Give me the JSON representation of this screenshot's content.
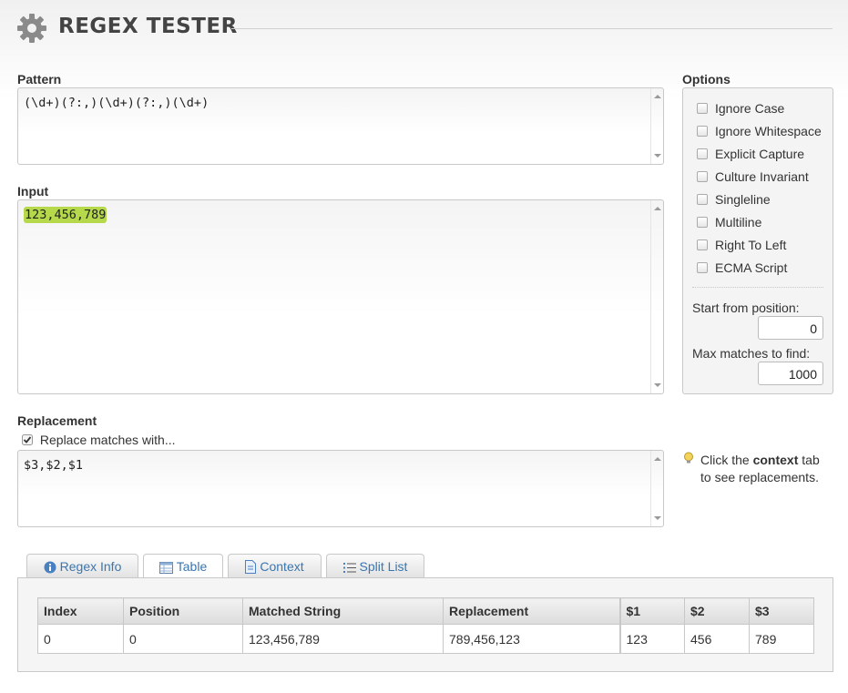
{
  "header": {
    "title": "REGEX TESTER",
    "logo_icon": "gear-icon"
  },
  "pattern": {
    "label": "Pattern",
    "value": "(\\d+)(?:,)(\\d+)(?:,)(\\d+)"
  },
  "input": {
    "label": "Input",
    "value": "123,456,789",
    "match_highlight_color": "#b5d94b"
  },
  "replacement": {
    "label": "Replacement",
    "checkbox_label": "Replace matches with...",
    "checkbox_checked": true,
    "value": "$3,$2,$1",
    "hint_prefix": "Click the ",
    "hint_bold": "context",
    "hint_suffix": " tab",
    "hint_line2": "to see replacements.",
    "hint_icon": "lightbulb-icon"
  },
  "options": {
    "label": "Options",
    "items": [
      {
        "label": "Ignore Case",
        "checked": false
      },
      {
        "label": "Ignore Whitespace",
        "checked": false
      },
      {
        "label": "Explicit Capture",
        "checked": false
      },
      {
        "label": "Culture Invariant",
        "checked": false
      },
      {
        "label": "Singleline",
        "checked": false
      },
      {
        "label": "Multiline",
        "checked": false
      },
      {
        "label": "Right To Left",
        "checked": false
      },
      {
        "label": "ECMA Script",
        "checked": false
      }
    ],
    "start_label": "Start from position:",
    "start_value": "0",
    "max_label": "Max matches to find:",
    "max_value": "1000"
  },
  "tabs": [
    {
      "label": "Regex Info",
      "icon": "info-icon",
      "active": false
    },
    {
      "label": "Table",
      "icon": "table-icon",
      "active": true
    },
    {
      "label": "Context",
      "icon": "document-icon",
      "active": false
    },
    {
      "label": "Split List",
      "icon": "list-icon",
      "active": false
    }
  ],
  "results": {
    "headers": [
      "Index",
      "Position",
      "Matched String",
      "Replacement",
      "$1",
      "$2",
      "$3"
    ],
    "rows": [
      [
        "0",
        "0",
        "123,456,789",
        "789,456,123",
        "123",
        "456",
        "789"
      ]
    ]
  }
}
